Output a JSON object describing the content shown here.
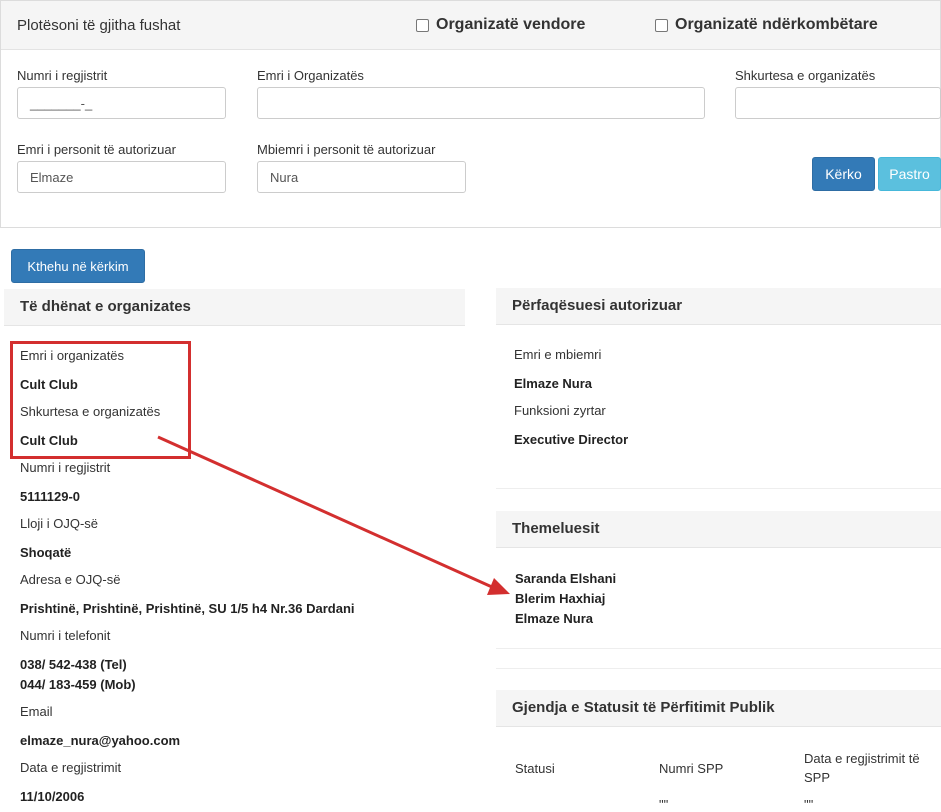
{
  "search_panel": {
    "title": "Plotësoni të gjitha fushat",
    "checkbox_local": "Organizatë vendore",
    "checkbox_international": "Organizatë ndërkombëtare",
    "reg_number_label": "Numri i regjistrit",
    "reg_number_value": "_______-_",
    "org_name_label": "Emri i Organizatës",
    "org_name_value": "",
    "abbreviation_label": "Shkurtesa e organizatës",
    "abbreviation_value": "",
    "auth_first_label": "Emri i personit të autorizuar",
    "auth_first_value": "Elmaze",
    "auth_last_label": "Mbiemri i personit të autorizuar",
    "auth_last_value": "Nura",
    "search_button": "Kërko",
    "clear_button": "Pastro"
  },
  "back_button": "Kthehu në kërkim",
  "org_data": {
    "heading": "Të dhënat e organizates",
    "name_label": "Emri i organizatës",
    "name_value": "Cult Club",
    "abbr_label": "Shkurtesa e organizatës",
    "abbr_value": "Cult Club",
    "reg_label": "Numri i regjistrit",
    "reg_value": "5111129-0",
    "type_label": "Lloji i OJQ-së",
    "type_value": "Shoqatë",
    "address_label": "Adresa e OJQ-së",
    "address_value": "Prishtinë, Prishtinë, Prishtinë, SU 1/5 h4 Nr.36 Dardani",
    "phone_label": "Numri i telefonit",
    "phone_value_1": "038/ 542-438 (Tel)",
    "phone_value_2": "044/ 183-459 (Mob)",
    "email_label": "Email",
    "email_value": "elmaze_nura@yahoo.com",
    "date_label": "Data e regjistrimit",
    "date_value": "11/10/2006"
  },
  "representative": {
    "heading": "Përfaqësuesi autorizuar",
    "name_label": "Emri e mbiemri",
    "name_value": "Elmaze Nura",
    "function_label": "Funksioni zyrtar",
    "function_value": "Executive Director"
  },
  "founders": {
    "heading": "Themeluesit",
    "names": [
      "Saranda Elshani",
      "Blerim Haxhiaj",
      "Elmaze Nura"
    ]
  },
  "public_benefit": {
    "heading": "Gjendja e Statusit të Përfitimit Publik",
    "col_status": "Statusi",
    "col_number": "Numri SPP",
    "col_date_1": "Data e regjistrimit të",
    "col_date_2": "SPP",
    "cell_number": "\"\"",
    "cell_date": "\"\""
  },
  "colors": {
    "annotation": "#d32f2f",
    "primary": "#337ab7",
    "info": "#5bc0de"
  }
}
